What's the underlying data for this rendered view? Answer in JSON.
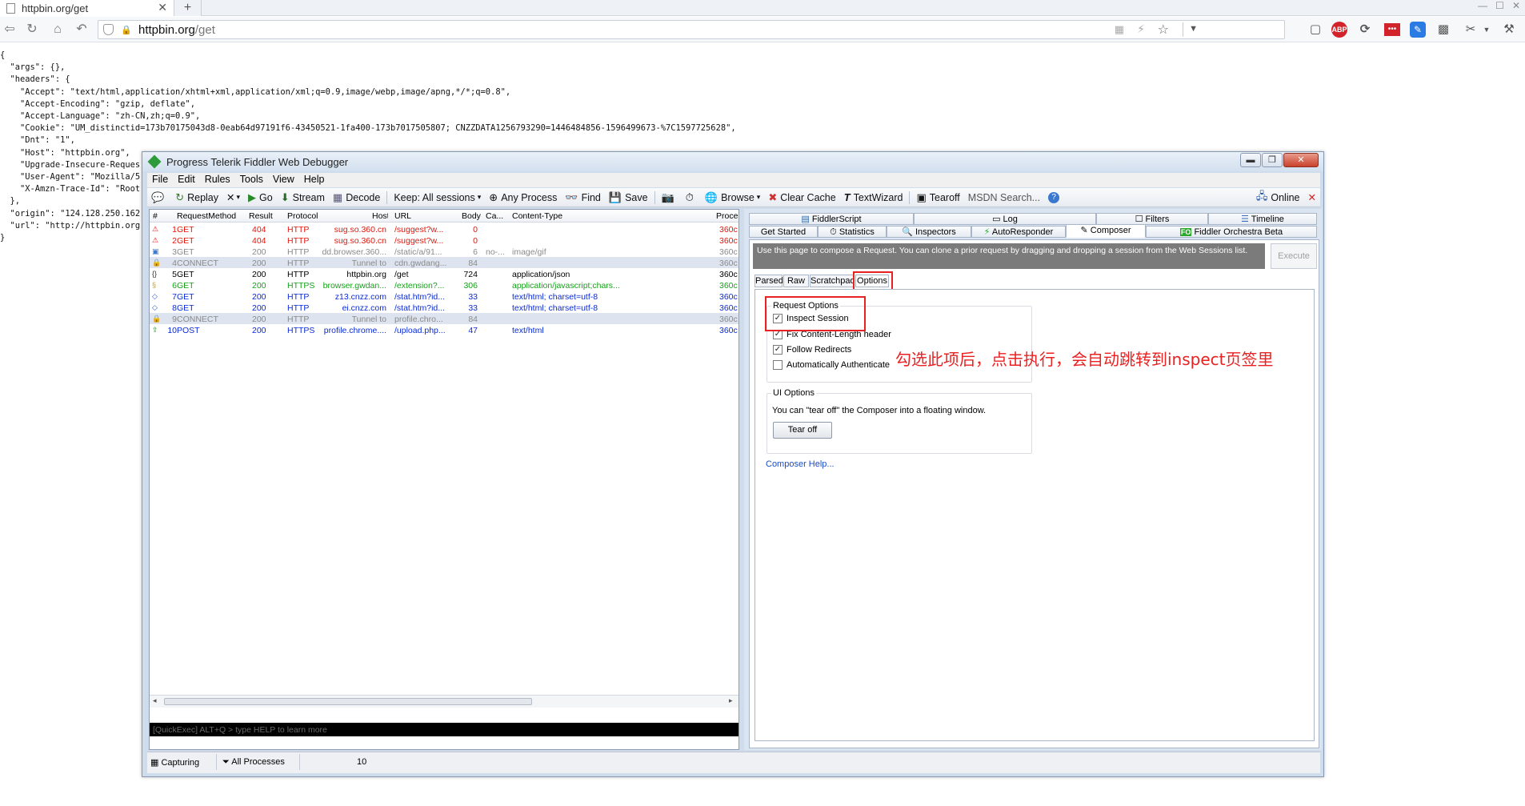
{
  "browser": {
    "tab_title": "httpbin.org/get",
    "url_host": "httpbin.org",
    "url_path": "/get"
  },
  "json_text": "{\n  \"args\": {},\n  \"headers\": {\n    \"Accept\": \"text/html,application/xhtml+xml,application/xml;q=0.9,image/webp,image/apng,*/*;q=0.8\",\n    \"Accept-Encoding\": \"gzip, deflate\",\n    \"Accept-Language\": \"zh-CN,zh;q=0.9\",\n    \"Cookie\": \"UM_distinctid=173b70175043d8-0eab64d97191f6-43450521-1fa400-173b7017505807; CNZZDATA1256793290=1446484856-1596499673-%7C1597725628\",\n    \"Dnt\": \"1\",\n    \"Host\": \"httpbin.org\",\n    \"Upgrade-Insecure-Reques\n    \"User-Agent\": \"Mozilla/5\n    \"X-Amzn-Trace-Id\": \"Root\n  },\n  \"origin\": \"124.128.250.162\n  \"url\": \"http://httpbin.org\n}",
  "fiddler": {
    "title": "Progress Telerik Fiddler Web Debugger",
    "menu": [
      "File",
      "Edit",
      "Rules",
      "Tools",
      "View",
      "Help"
    ],
    "toolbar": {
      "replay": "Replay",
      "remove": "✕",
      "go": "Go",
      "stream": "Stream",
      "decode": "Decode",
      "keep": "Keep: All sessions",
      "any_process": "Any Process",
      "find": "Find",
      "save": "Save",
      "browse": "Browse",
      "clear_cache": "Clear Cache",
      "textwizard": "TextWizard",
      "tearoff": "Tearoff",
      "msdn": "MSDN Search...",
      "online": "Online"
    },
    "columns": [
      "#",
      "RequestMethod",
      "Result",
      "Protocol",
      "Host",
      "URL",
      "Body",
      "Ca...",
      "Content-Type",
      "Proce"
    ],
    "sessions": [
      {
        "num": "1",
        "method": "GET",
        "result": "404",
        "protocol": "HTTP",
        "host": "sug.so.360.cn",
        "url": "/suggest?w...",
        "body": "0",
        "cache": "",
        "ctype": "",
        "proc": "360c",
        "style": "err",
        "icon": "warning-icon"
      },
      {
        "num": "2",
        "method": "GET",
        "result": "404",
        "protocol": "HTTP",
        "host": "sug.so.360.cn",
        "url": "/suggest?w...",
        "body": "0",
        "cache": "",
        "ctype": "",
        "proc": "360c",
        "style": "err",
        "icon": "warning-icon"
      },
      {
        "num": "3",
        "method": "GET",
        "result": "200",
        "protocol": "HTTP",
        "host": "dd.browser.360...",
        "url": "/static/a/91...",
        "body": "6",
        "cache": "no-...",
        "ctype": "image/gif",
        "proc": "360c",
        "style": "gray",
        "icon": "image-icon"
      },
      {
        "num": "4",
        "method": "CONNECT",
        "result": "200",
        "protocol": "HTTP",
        "host": "Tunnel to",
        "url": "cdn.gwdang...",
        "body": "84",
        "cache": "",
        "ctype": "",
        "proc": "360c",
        "style": "conn",
        "icon": "lock-icon"
      },
      {
        "num": "5",
        "method": "GET",
        "result": "200",
        "protocol": "HTTP",
        "host": "httpbin.org",
        "url": "/get",
        "body": "724",
        "cache": "",
        "ctype": "application/json",
        "proc": "360c",
        "style": "black",
        "icon": "json-icon"
      },
      {
        "num": "6",
        "method": "GET",
        "result": "200",
        "protocol": "HTTPS",
        "host": "browser.gwdan...",
        "url": "/extension?...",
        "body": "306",
        "cache": "",
        "ctype": "application/javascript;chars...",
        "proc": "360c",
        "style": "green",
        "icon": "script-icon"
      },
      {
        "num": "7",
        "method": "GET",
        "result": "200",
        "protocol": "HTTP",
        "host": "z13.cnzz.com",
        "url": "/stat.htm?id...",
        "body": "33",
        "cache": "",
        "ctype": "text/html; charset=utf-8",
        "proc": "360c",
        "style": "blue",
        "icon": "html-icon"
      },
      {
        "num": "8",
        "method": "GET",
        "result": "200",
        "protocol": "HTTP",
        "host": "ei.cnzz.com",
        "url": "/stat.htm?id...",
        "body": "33",
        "cache": "",
        "ctype": "text/html; charset=utf-8",
        "proc": "360c",
        "style": "blue",
        "icon": "html-icon"
      },
      {
        "num": "9",
        "method": "CONNECT",
        "result": "200",
        "protocol": "HTTP",
        "host": "Tunnel to",
        "url": "profile.chro...",
        "body": "84",
        "cache": "",
        "ctype": "",
        "proc": "360c",
        "style": "conn",
        "icon": "lock-icon"
      },
      {
        "num": "10",
        "method": "POST",
        "result": "200",
        "protocol": "HTTPS",
        "host": "profile.chrome....",
        "url": "/upload.php...",
        "body": "47",
        "cache": "",
        "ctype": "text/html",
        "proc": "360c",
        "style": "blue",
        "icon": "upload-icon"
      }
    ],
    "quickexec_placeholder": "[QuickExec] ALT+Q > type HELP to learn more",
    "status": {
      "capturing": "Capturing",
      "processes": "All Processes",
      "count": "10"
    },
    "right_tabs_row1": [
      "FiddlerScript",
      "Log",
      "Filters",
      "Timeline"
    ],
    "right_tabs_row2": [
      "Get Started",
      "Statistics",
      "Inspectors",
      "AutoResponder",
      "Composer",
      "Fiddler Orchestra Beta"
    ],
    "composer": {
      "info": "Use this page to compose a Request. You can clone a prior request by dragging and dropping a session from the Web Sessions list.",
      "execute": "Execute",
      "subtabs": [
        "Parsed",
        "Raw",
        "Scratchpad",
        "Options"
      ],
      "request_options_label": "Request Options",
      "options": [
        {
          "label": "Inspect Session",
          "checked": true
        },
        {
          "label": "Fix Content-Length header",
          "checked": true
        },
        {
          "label": "Follow Redirects",
          "checked": true
        },
        {
          "label": "Automatically Authenticate",
          "checked": false
        }
      ],
      "ui_options_label": "UI Options",
      "ui_text": "You can \"tear off\" the Composer into a floating window.",
      "tearoff_button": "Tear off",
      "help_link": "Composer Help..."
    }
  },
  "annotation": "勾选此项后，点击执行，会自动跳转到inspect页签里",
  "colors": {
    "annotation": "#e82222",
    "error": "#e3170d",
    "ok_blue": "#0a2bd8",
    "https_green": "#16a11a"
  }
}
